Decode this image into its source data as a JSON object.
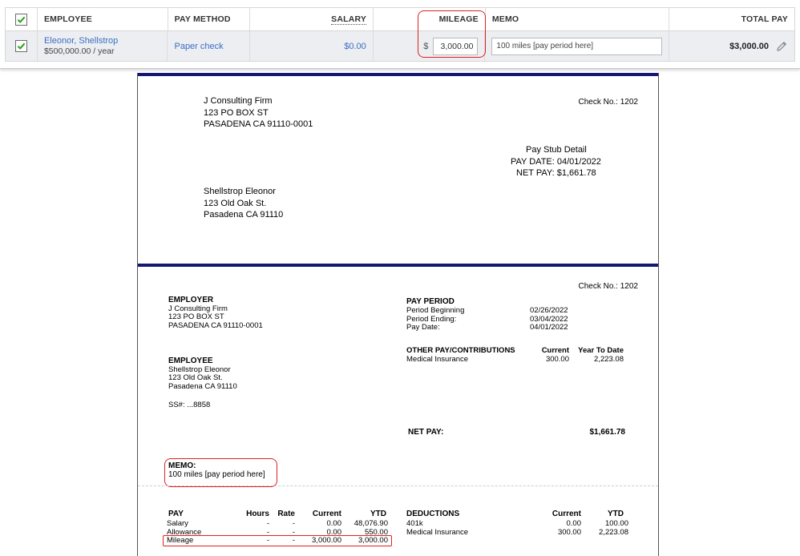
{
  "payroll": {
    "headers": {
      "employee": "EMPLOYEE",
      "pay_method": "PAY METHOD",
      "salary": "SALARY",
      "mileage": "MILEAGE",
      "memo": "MEMO",
      "total_pay": "TOTAL PAY"
    },
    "row": {
      "employee_name": "Eleonor, Shellstrop",
      "employee_salary": "$500,000.00 / year",
      "pay_method": "Paper check",
      "salary": "$0.00",
      "mileage_currency": "$",
      "mileage_value": "3,000.00",
      "memo_value": "100 miles [pay period here]",
      "total_pay": "$3,000.00"
    }
  },
  "stub": {
    "company": {
      "name": "J Consulting Firm",
      "street": "123  PO BOX ST",
      "city": "PASADENA CA 91110-0001"
    },
    "check_no": "Check No.: 1202",
    "detail_title": "Pay Stub Detail",
    "pay_date_line": "PAY DATE: 04/01/2022",
    "net_pay_line": "NET PAY: $1,661.78",
    "recipient": {
      "name": "Shellstrop Eleonor",
      "street": "123 Old Oak St.",
      "city": "Pasadena CA 91110"
    },
    "employer_heading": "EMPLOYER",
    "employee_heading": "EMPLOYEE",
    "ss": "SS#: ...8858",
    "pay_period": {
      "heading": "PAY PERIOD",
      "rows": [
        {
          "label": "Period Beginning",
          "value": "02/26/2022"
        },
        {
          "label": "Period Ending:",
          "value": "03/04/2022"
        },
        {
          "label": "Pay Date:",
          "value": "04/01/2022"
        }
      ]
    },
    "other_pay": {
      "heading": "OTHER PAY/CONTRIBUTIONS",
      "current_heading": "Current",
      "ytd_heading": "Year To Date",
      "rows": [
        {
          "label": "Medical Insurance",
          "current": "300.00",
          "ytd": "2,223.08"
        }
      ]
    },
    "net_pay": {
      "label": "NET PAY:",
      "value": "$1,661.78"
    },
    "memo": {
      "heading": "MEMO:",
      "text": "100 miles [pay period here]"
    },
    "pay_table": {
      "headers": {
        "pay": "PAY",
        "hours": "Hours",
        "rate": "Rate",
        "current": "Current",
        "ytd": "YTD"
      },
      "rows": [
        {
          "label": "Salary",
          "hours": "-",
          "rate": "-",
          "current": "0.00",
          "ytd": "48,076.90"
        },
        {
          "label": "Allowance",
          "hours": "-",
          "rate": "-",
          "current": "0.00",
          "ytd": "550.00"
        },
        {
          "label": "Mileage",
          "hours": "-",
          "rate": "-",
          "current": "3,000.00",
          "ytd": "3,000.00"
        }
      ]
    },
    "deductions": {
      "headers": {
        "label": "DEDUCTIONS",
        "current": "Current",
        "ytd": "YTD"
      },
      "rows": [
        {
          "label": "401k",
          "current": "0.00",
          "ytd": "100.00"
        },
        {
          "label": "Medical Insurance",
          "current": "300.00",
          "ytd": "2,223.08"
        }
      ]
    }
  },
  "colors": {
    "link_blue": "#3b6ec2",
    "check_green": "#2ca01c",
    "highlight_red": "#e02020",
    "stub_navy": "#161773"
  },
  "icons": [
    "checkbox-checked-icon",
    "pencil-icon"
  ]
}
